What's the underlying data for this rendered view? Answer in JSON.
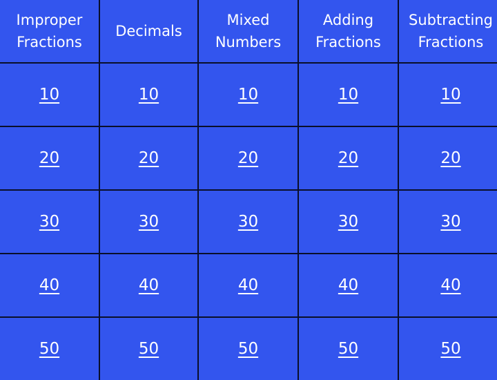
{
  "board": {
    "categories": [
      "Improper\nFractions",
      "Decimals",
      "Mixed\nNumbers",
      "Adding\nFractions",
      "Subtracting\nFractions"
    ],
    "point_values": [
      "10",
      "20",
      "30",
      "40",
      "50"
    ],
    "colors": {
      "cell": "#3355ee",
      "grid": "#0a0f2a",
      "text": "#ffffff"
    }
  }
}
